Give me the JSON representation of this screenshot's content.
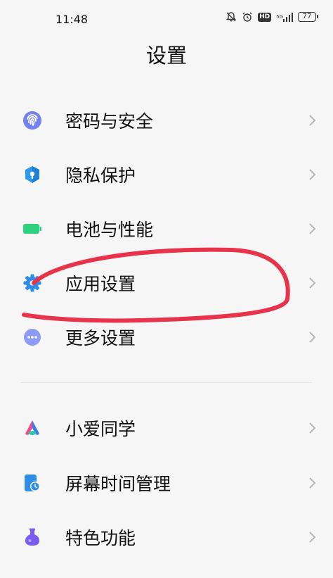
{
  "status_bar": {
    "time": "11:48",
    "network_label": "5G",
    "hd_label": "HD",
    "battery_level": "77"
  },
  "page": {
    "title": "设置"
  },
  "group1": [
    {
      "label": "密码与安全",
      "icon": "fingerprint-icon",
      "color": "#6f7bf0"
    },
    {
      "label": "隐私保护",
      "icon": "shield-icon",
      "color": "#2d9af0"
    },
    {
      "label": "电池与性能",
      "icon": "battery-icon",
      "color": "#2fd27c"
    },
    {
      "label": "应用设置",
      "icon": "gear-icon",
      "color": "#2c8de8"
    },
    {
      "label": "更多设置",
      "icon": "more-icon",
      "color": "#8c9bf5"
    }
  ],
  "group2": [
    {
      "label": "小爱同学",
      "icon": "xiaoai-icon"
    },
    {
      "label": "屏幕时间管理",
      "icon": "screen-time-icon",
      "color": "#2d8de8"
    },
    {
      "label": "特色功能",
      "icon": "flask-icon",
      "color": "#7a5cf0"
    }
  ],
  "annotation": {
    "color": "#e8344a"
  }
}
